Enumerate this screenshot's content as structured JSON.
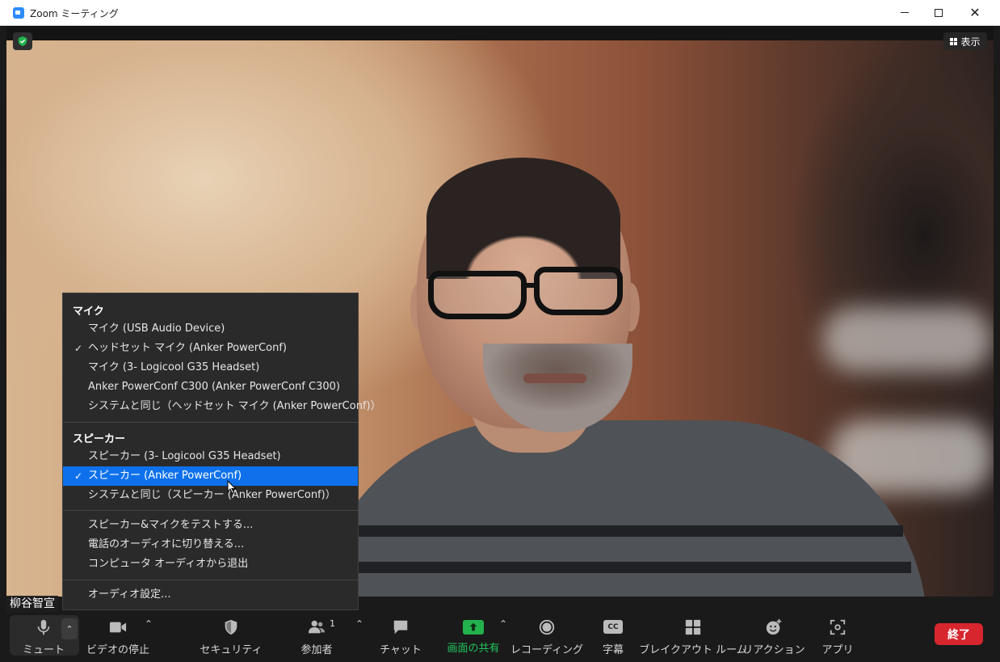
{
  "window": {
    "title": "Zoom ミーティング"
  },
  "video": {
    "view_label": "表示",
    "participant_name": "柳谷智宣"
  },
  "audio_menu": {
    "mic_heading": "マイク",
    "mic_items": [
      {
        "label": "マイク (USB Audio Device)",
        "checked": false
      },
      {
        "label": "ヘッドセット マイク (Anker PowerConf)",
        "checked": true
      },
      {
        "label": "マイク (3- Logicool G35 Headset)",
        "checked": false
      },
      {
        "label": "Anker PowerConf C300 (Anker PowerConf C300)",
        "checked": false
      },
      {
        "label": "システムと同じ（ヘッドセット マイク (Anker PowerConf)）",
        "checked": false
      }
    ],
    "speaker_heading": "スピーカー",
    "speaker_items": [
      {
        "label": "スピーカー (3- Logicool G35 Headset)",
        "checked": false
      },
      {
        "label": "スピーカー (Anker PowerConf)",
        "checked": true
      },
      {
        "label": "システムと同じ（スピーカー (Anker PowerConf)）",
        "checked": false
      }
    ],
    "actions": [
      "スピーカー&マイクをテストする...",
      "電話のオーディオに切り替える...",
      "コンピュータ オーディオから退出"
    ],
    "settings": "オーディオ設定..."
  },
  "toolbar": {
    "mute": "ミュート",
    "video": "ビデオの停止",
    "security": "セキュリティ",
    "participants": "参加者",
    "participant_count": "1",
    "chat": "チャット",
    "share": "画面の共有",
    "record": "レコーディング",
    "captions": "字幕",
    "captions_icon_text": "CC",
    "breakout": "ブレイクアウト ルーム",
    "reactions": "リアクション",
    "apps": "アプリ",
    "end": "終了"
  },
  "colors": {
    "share_green": "#22b14c",
    "end_red": "#d7262e",
    "menu_selected": "#0e71eb"
  }
}
